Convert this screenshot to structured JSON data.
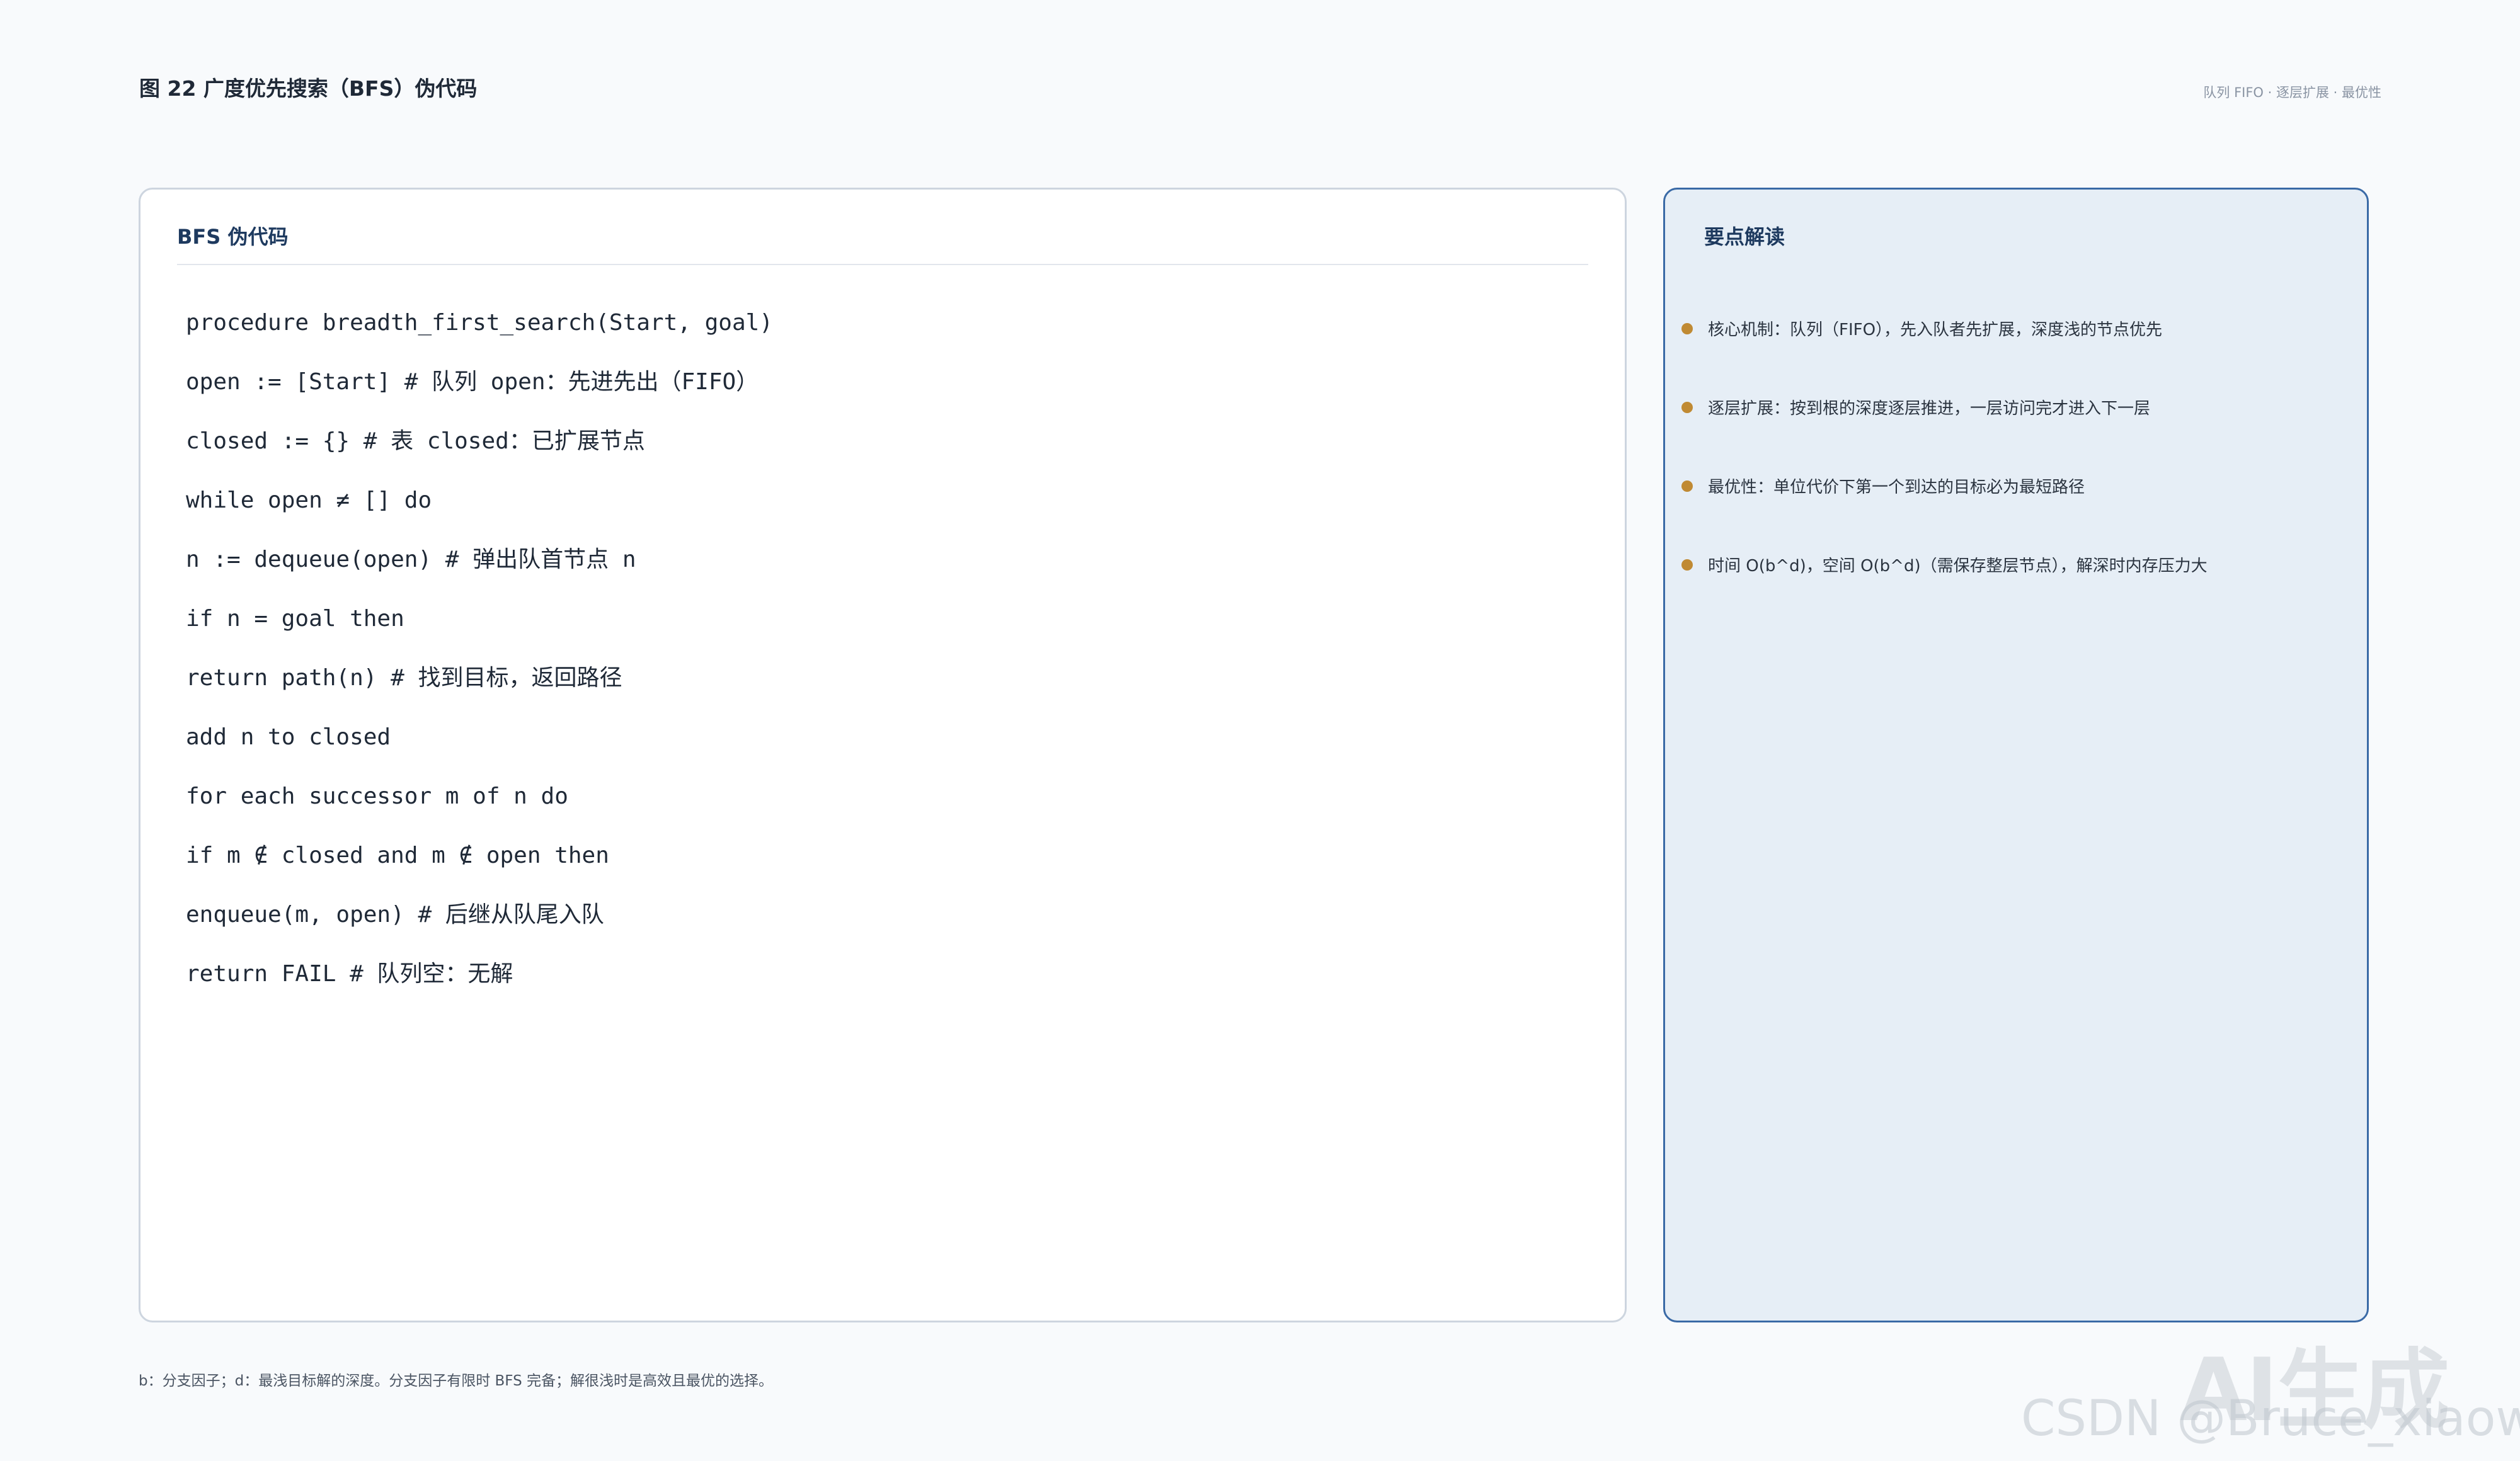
{
  "header": {
    "title": "图 22 广度优先搜索（BFS）伪代码",
    "tagline": "队列 FIFO · 逐层扩展 · 最优性"
  },
  "code_panel": {
    "title": "BFS 伪代码",
    "lines": [
      "procedure breadth_first_search(Start, goal)",
      "open := [Start] # 队列 open：先进先出（FIFO）",
      "closed := {} # 表 closed：已扩展节点",
      "while open ≠ [] do",
      "n := dequeue(open) # 弹出队首节点 n",
      "if n = goal then",
      "return path(n) # 找到目标，返回路径",
      "add n to closed",
      "for each successor m of n do",
      "if m ∉ closed and m ∉ open then",
      "enqueue(m, open) # 后继从队尾入队",
      "return FAIL # 队列空：无解"
    ]
  },
  "notes_panel": {
    "title": "要点解读",
    "items": [
      "核心机制：队列（FIFO），先入队者先扩展，深度浅的节点优先",
      "逐层扩展：按到根的深度逐层推进，一层访问完才进入下一层",
      "最优性：单位代价下第一个到达的目标必为最短路径",
      "时间 O(b^d)，空间 O(b^d)（需保存整层节点），解深时内存压力大"
    ]
  },
  "footnote": "b：分支因子；d：最浅目标解的深度。分支因子有限时 BFS 完备；解很浅时是高效且最优的选择。",
  "watermark": {
    "ai_label": "AI生成",
    "source": "CSDN @Bruce_xiaowei"
  },
  "colors": {
    "background": "#f8fafc",
    "accent": "#1e3a5f",
    "notes_border": "#3a6aa6",
    "notes_bg": "#e6eef6",
    "bullet": "#c08a33"
  }
}
